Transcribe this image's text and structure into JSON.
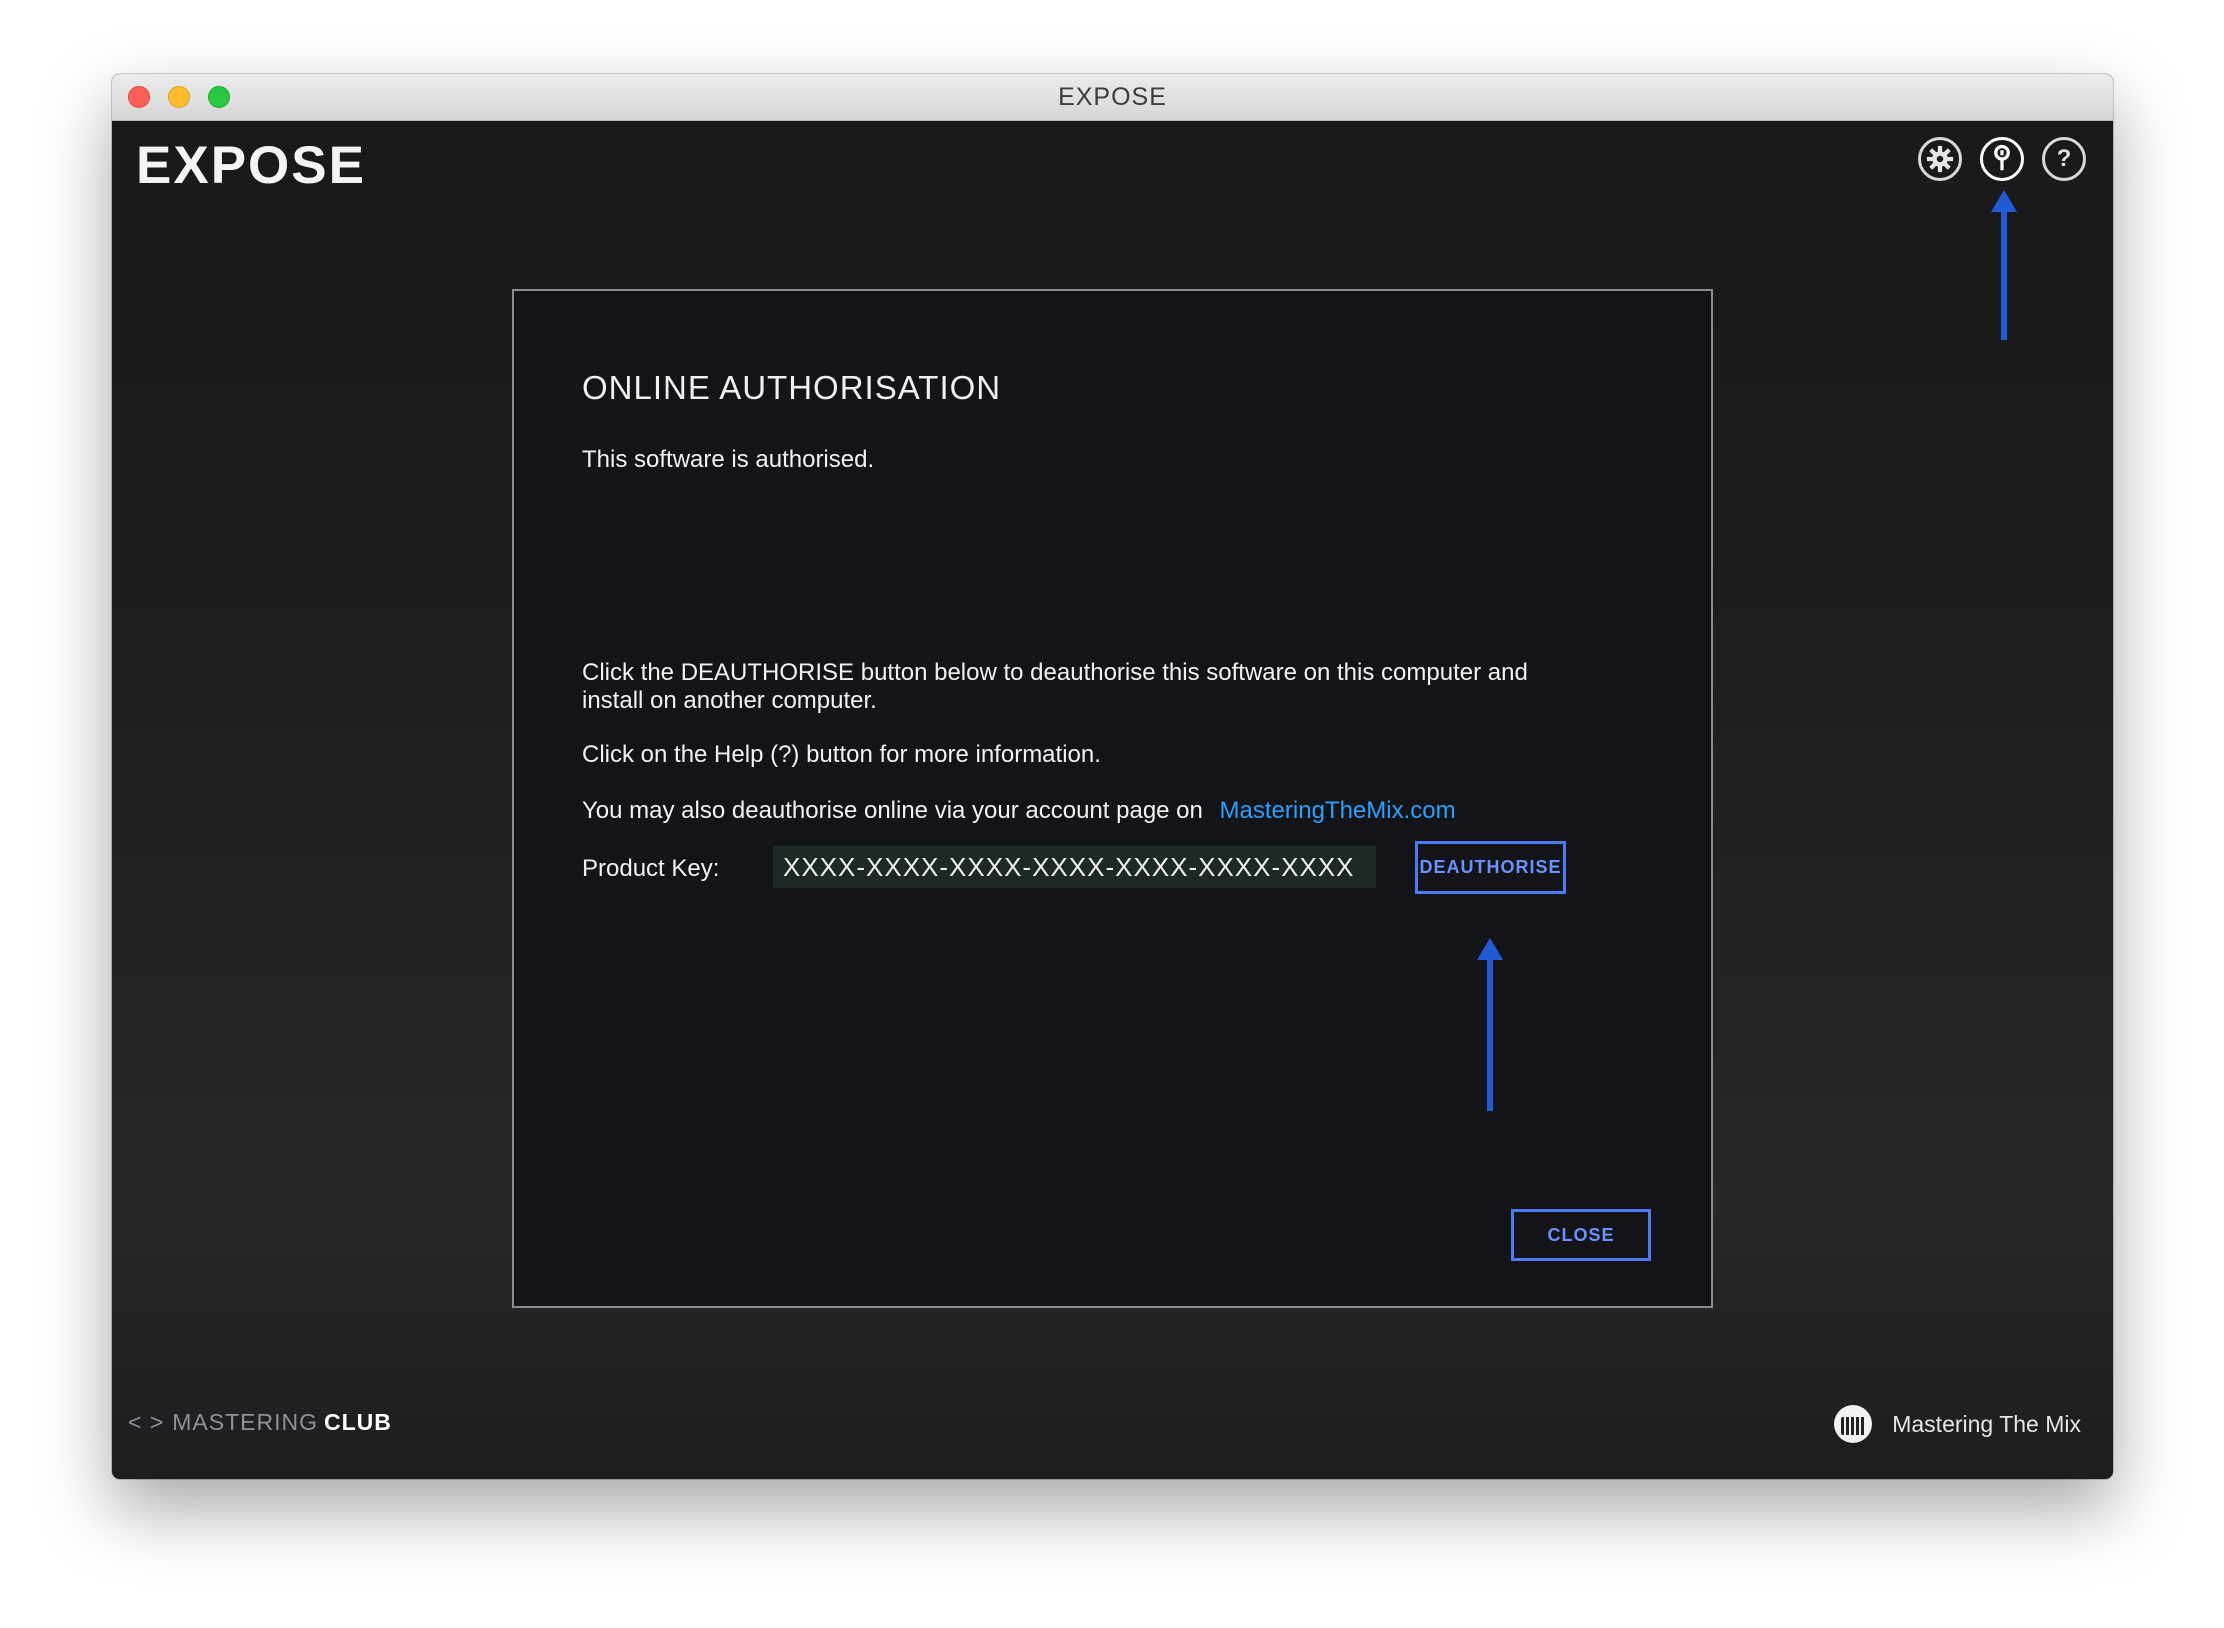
{
  "window": {
    "title": "EXPOSE"
  },
  "app": {
    "logo": "EXPOSE",
    "toolbar": {
      "settings_icon": "gear-icon",
      "auth_icon": "key-icon",
      "help_icon": "question-icon",
      "help_glyph": "?"
    }
  },
  "dialog": {
    "title": "ONLINE AUTHORISATION",
    "status": "This software is authorised.",
    "instructions": "Click the DEAUTHORISE button below to deauthorise this software on this computer and install on another computer.",
    "help_text": "Click on the Help (?) button for more information.",
    "online_text": "You may also deauthorise online via your account page on",
    "link_text": "MasteringTheMix.com",
    "product_key_label": "Product Key:",
    "product_key_value": "XXXX-XXXX-XXXX-XXXX-XXXX-XXXX-XXXX",
    "deauthorise_button": "DEAUTHORISE",
    "close_button": "CLOSE"
  },
  "footer": {
    "left_chevrons": "< >",
    "left_brand_light": "MASTERING",
    "left_brand_bold": "CLUB",
    "right_brand": "Mastering The Mix"
  },
  "colors": {
    "accent": "#4b7af5",
    "link": "#2aa0ff",
    "annotation": "#1f5bd6"
  }
}
